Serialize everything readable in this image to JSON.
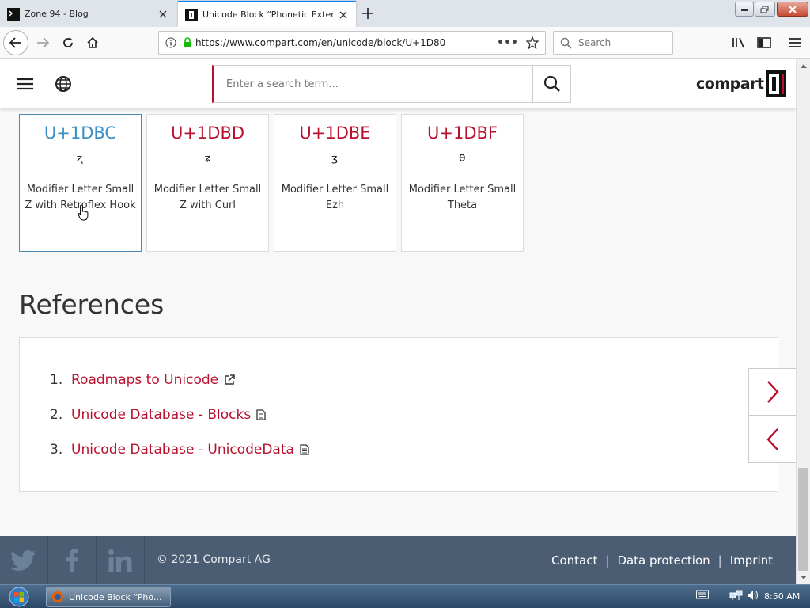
{
  "browser": {
    "tabs": [
      {
        "title": "Zone 94 - Blog"
      },
      {
        "title": "Unicode Block “Phonetic Extensions Supplement”"
      }
    ],
    "url": "https://www.compart.com/en/unicode/block/U+1D80",
    "search_placeholder": "Search"
  },
  "site": {
    "search_placeholder": "Enter a search term...",
    "logo_text": "compart",
    "brand_color": "#b8112d"
  },
  "cards": [
    {
      "code": "U+1DBC",
      "glyph": "ᶼ",
      "name": "Modifier Letter Small Z with Retroflex Hook"
    },
    {
      "code": "U+1DBD",
      "glyph": "ᶽ",
      "name": "Modifier Letter Small Z with Curl"
    },
    {
      "code": "U+1DBE",
      "glyph": "ᶾ",
      "name": "Modifier Letter Small Ezh"
    },
    {
      "code": "U+1DBF",
      "glyph": "ᶿ",
      "name": "Modifier Letter Small Theta"
    }
  ],
  "references": {
    "title": "References",
    "items": [
      {
        "num": "1.",
        "label": "Roadmaps to Unicode",
        "icon": "external-link-icon"
      },
      {
        "num": "2.",
        "label": "Unicode Database - Blocks",
        "icon": "document-icon"
      },
      {
        "num": "3.",
        "label": "Unicode Database - UnicodeData",
        "icon": "document-icon"
      }
    ]
  },
  "footer": {
    "copyright": "© 2021 Compart AG",
    "links": [
      "Contact",
      "Data protection",
      "Imprint"
    ],
    "social": [
      "twitter-icon",
      "facebook-icon",
      "linkedin-icon"
    ]
  },
  "taskbar": {
    "task_label": "Unicode Block “Pho...",
    "clock": "8:50 AM"
  }
}
